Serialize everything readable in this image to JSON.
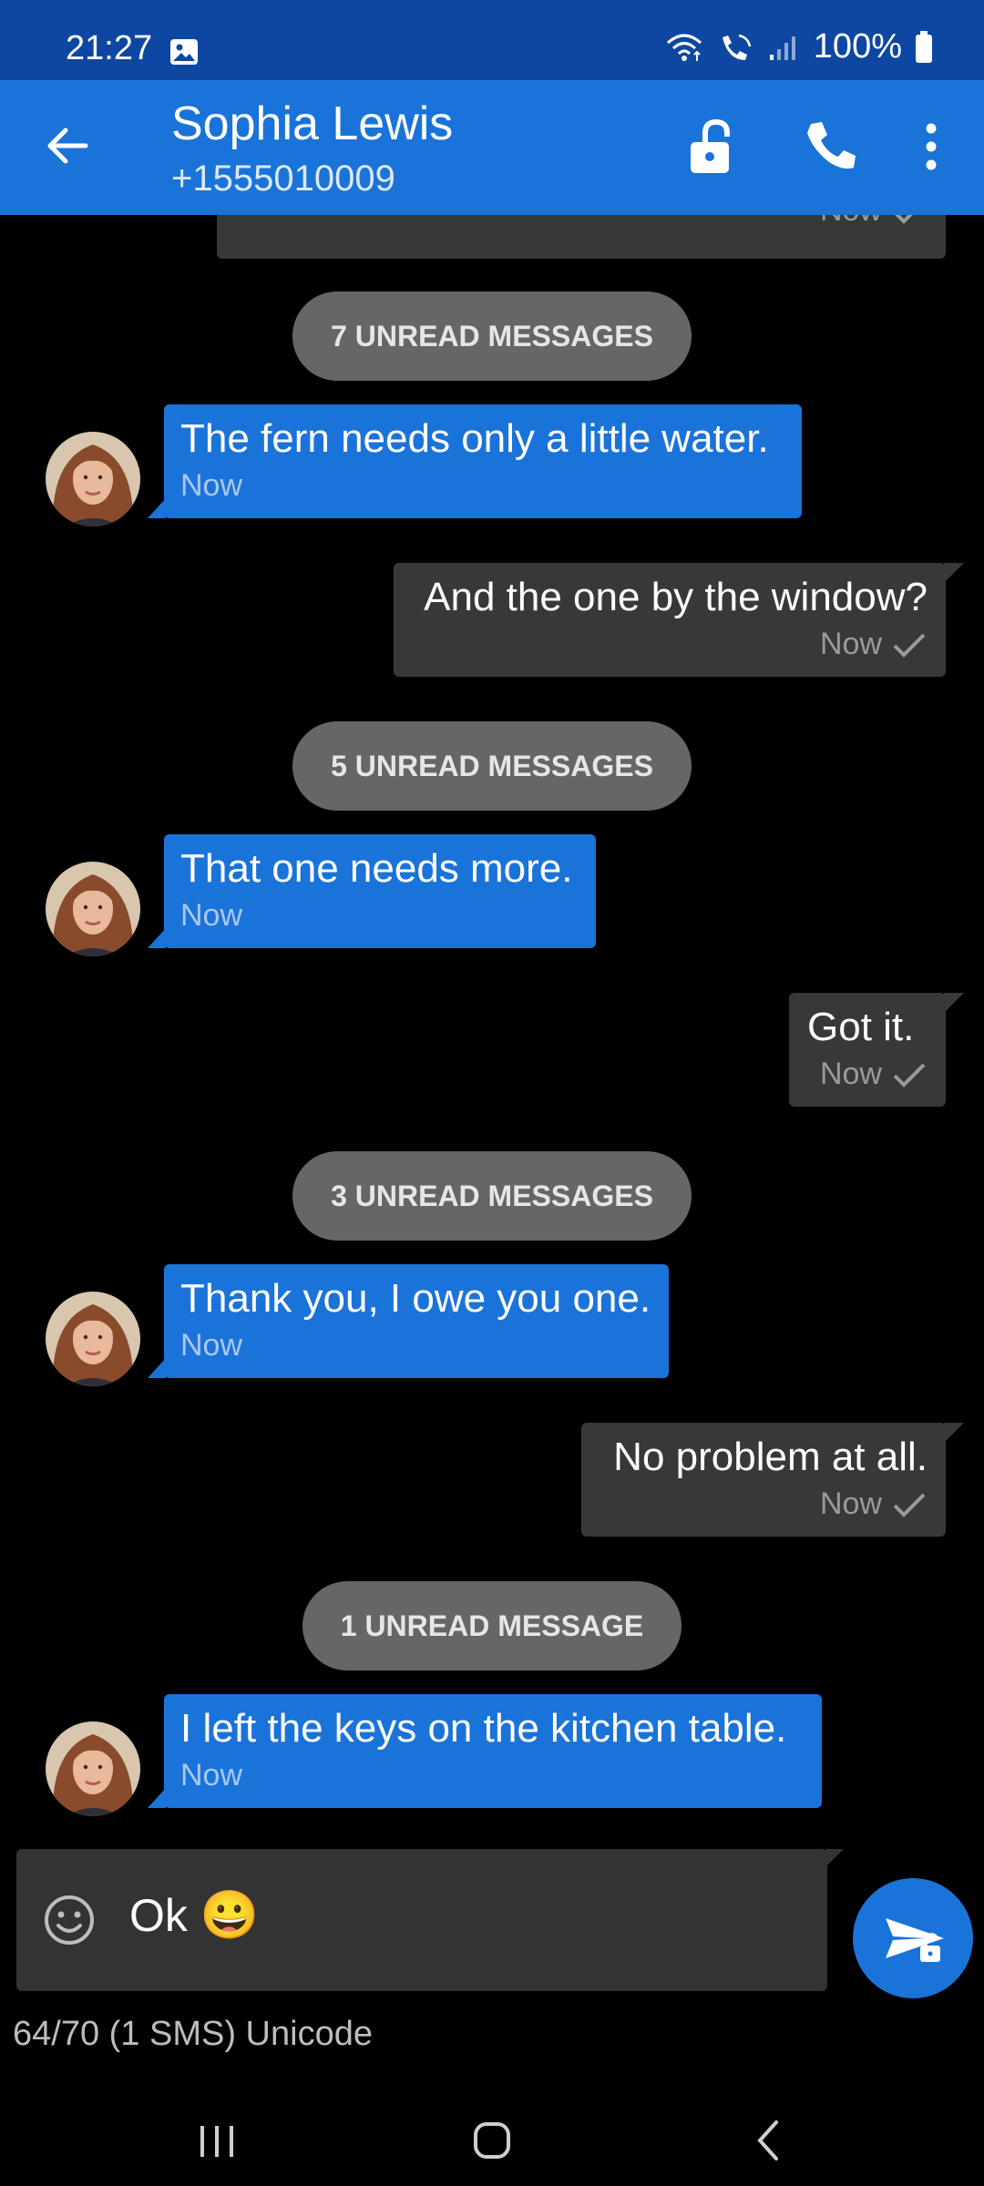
{
  "status_bar": {
    "time": "21:27",
    "battery": "100%"
  },
  "header": {
    "contact_name": "Sophia Lewis",
    "contact_number": "+1555010009"
  },
  "messages": [
    {
      "type": "out-partial",
      "time": "Now"
    },
    {
      "type": "divider",
      "label": "7 UNREAD MESSAGES"
    },
    {
      "type": "in",
      "text": "The fern needs only a little water.",
      "time": "Now"
    },
    {
      "type": "out",
      "text": "And the one by the window?",
      "time": "Now"
    },
    {
      "type": "divider",
      "label": "5 UNREAD MESSAGES"
    },
    {
      "type": "in",
      "text": "That one needs more.",
      "time": "Now"
    },
    {
      "type": "out",
      "text": "Got it.",
      "time": "Now"
    },
    {
      "type": "divider",
      "label": "3 UNREAD MESSAGES"
    },
    {
      "type": "in",
      "text": "Thank you, I owe you one.",
      "time": "Now"
    },
    {
      "type": "out",
      "text": "No problem at all.",
      "time": "Now"
    },
    {
      "type": "divider",
      "label": "1 UNREAD MESSAGE"
    },
    {
      "type": "in",
      "text": "I left the keys on the kitchen table.",
      "time": "Now"
    }
  ],
  "composer": {
    "value": "Ok",
    "emoji": "😀"
  },
  "counter": "64/70 (1 SMS)  Unicode",
  "colors": {
    "accent": "#1a73d9",
    "status_bar": "#0d47a1",
    "outgoing": "#383838",
    "divider": "#666666"
  }
}
